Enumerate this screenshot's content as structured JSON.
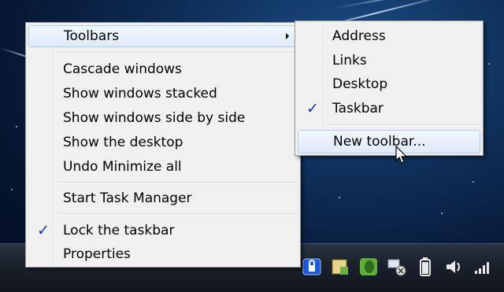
{
  "context_menu": {
    "items": [
      {
        "label": "Toolbars",
        "has_submenu": true,
        "highlighted": true
      },
      {
        "label": "Cascade windows"
      },
      {
        "label": "Show windows stacked"
      },
      {
        "label": "Show windows side by side"
      },
      {
        "label": "Show the desktop"
      },
      {
        "label": "Undo Minimize all"
      },
      {
        "label": "Start Task Manager"
      },
      {
        "label": "Lock the taskbar",
        "checked": true
      },
      {
        "label": "Properties"
      }
    ]
  },
  "toolbars_submenu": {
    "items": [
      {
        "label": "Address"
      },
      {
        "label": "Links"
      },
      {
        "label": "Desktop"
      },
      {
        "label": "Taskbar",
        "checked": true
      },
      {
        "label": "New toolbar...",
        "highlighted": true
      }
    ]
  },
  "check_glyph": "✓",
  "tray_icons": [
    "security-shield-icon",
    "notes-icon",
    "evernote-icon",
    "network-icon",
    "battery-icon",
    "volume-icon",
    "signal-bars-icon"
  ],
  "colors": {
    "menu_bg": "#f0f0f0",
    "highlight": "#dfeafa",
    "check": "#0b3b9e"
  }
}
